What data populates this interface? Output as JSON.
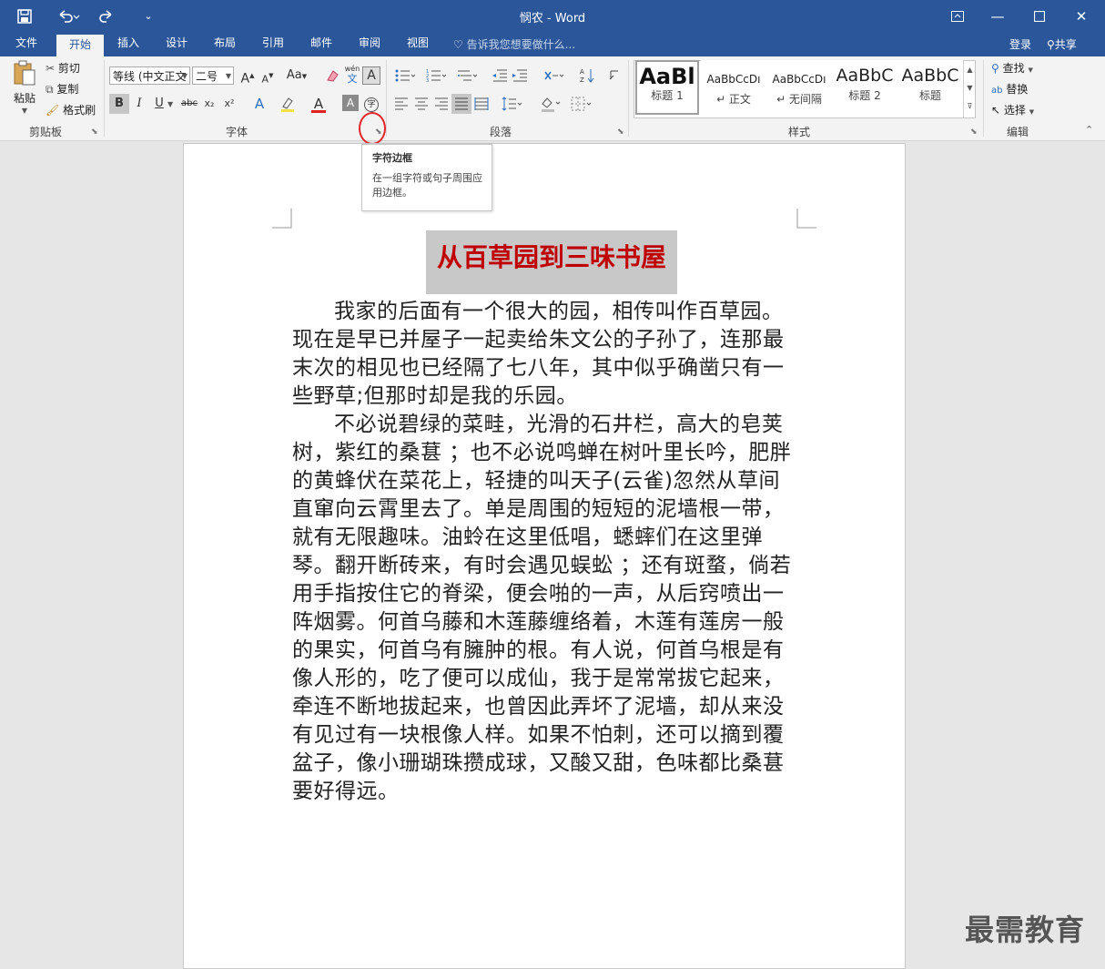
{
  "window": {
    "title": "悯农 - Word",
    "login_label": "登录",
    "share_label": "共享"
  },
  "quick_access": {
    "save_icon": "save-icon",
    "undo_icon": "undo-icon",
    "redo_icon": "redo-icon",
    "customize_icon": "customize-icon"
  },
  "tabs": [
    {
      "label": "文件"
    },
    {
      "label": "开始"
    },
    {
      "label": "插入"
    },
    {
      "label": "设计"
    },
    {
      "label": "布局"
    },
    {
      "label": "引用"
    },
    {
      "label": "邮件"
    },
    {
      "label": "审阅"
    },
    {
      "label": "视图"
    }
  ],
  "tell_me": {
    "placeholder": "告诉我您想要做什么..."
  },
  "ribbon": {
    "clipboard": {
      "paste_label": "粘贴",
      "cut_label": "剪切",
      "copy_label": "复制",
      "format_painter_label": "格式刷",
      "group_label": "剪贴板"
    },
    "font": {
      "font_name": "等线 (中文正文",
      "font_size": "二号",
      "group_label": "字体",
      "grow_label": "A",
      "shrink_label": "A",
      "case_label": "Aa",
      "bold_label": "B",
      "italic_label": "I",
      "underline_label": "U",
      "strike_label": "abc",
      "sub_label": "x₂",
      "sup_label": "x²",
      "phonetic_label": "wén",
      "phonetic_sub": "文",
      "border_label": "A",
      "color_label": "A",
      "shade_label": "A",
      "enclose_label": "字"
    },
    "paragraph": {
      "group_label": "段落"
    },
    "styles": {
      "group_label": "样式",
      "items": [
        {
          "sample": "AaBl",
          "name": "标题 1"
        },
        {
          "sample": "AaBbCcDı",
          "name": "↵ 正文"
        },
        {
          "sample": "AaBbCcDı",
          "name": "↵ 无间隔"
        },
        {
          "sample": "AaBbC",
          "name": "标题 2"
        },
        {
          "sample": "AaBbC",
          "name": "标题"
        }
      ]
    },
    "editing": {
      "group_label": "编辑",
      "find_label": "查找",
      "replace_label": "替换",
      "select_label": "选择"
    }
  },
  "tooltip": {
    "title": "字符边框",
    "body": "在一组字符或句子周围应用边框。"
  },
  "document": {
    "title": "从百草园到三味书屋",
    "paragraphs": [
      "我家的后面有一个很大的园，相传叫作百草园。现在是早已并屋子一起卖给朱文公的子孙了，连那最末次的相见也已经隔了七八年，其中似乎确凿只有一些野草;但那时却是我的乐园。",
      "不必说碧绿的菜畦，光滑的石井栏，高大的皂荚树，紫红的桑葚 ；也不必说鸣蝉在树叶里长吟，肥胖的黄蜂伏在菜花上，轻捷的叫天子(云雀)忽然从草间直窜向云霄里去了。单是周围的短短的泥墙根一带，就有无限趣味。油蛉在这里低唱，蟋蟀们在这里弹琴。翻开断砖来，有时会遇见蜈蚣 ；还有斑蝥，倘若用手指按住它的脊梁，便会啪的一声，从后窍喷出一阵烟雾。何首乌藤和木莲藤缠络着，木莲有莲房一般的果实，何首乌有臃肿的根。有人说，何首乌根是有像人形的，吃了便可以成仙，我于是常常拔它起来，牵连不断地拔起来，也曾因此弄坏了泥墙，却从来没有见过有一块根像人样。如果不怕刺，还可以摘到覆盆子，像小珊瑚珠攒成球，又酸又甜，色味都比桑葚要好得远。"
    ]
  },
  "watermark": "最需教育",
  "colors": {
    "brand": "#2b579a",
    "title_red": "#c00000",
    "highlight_ring": "#e0262a"
  }
}
